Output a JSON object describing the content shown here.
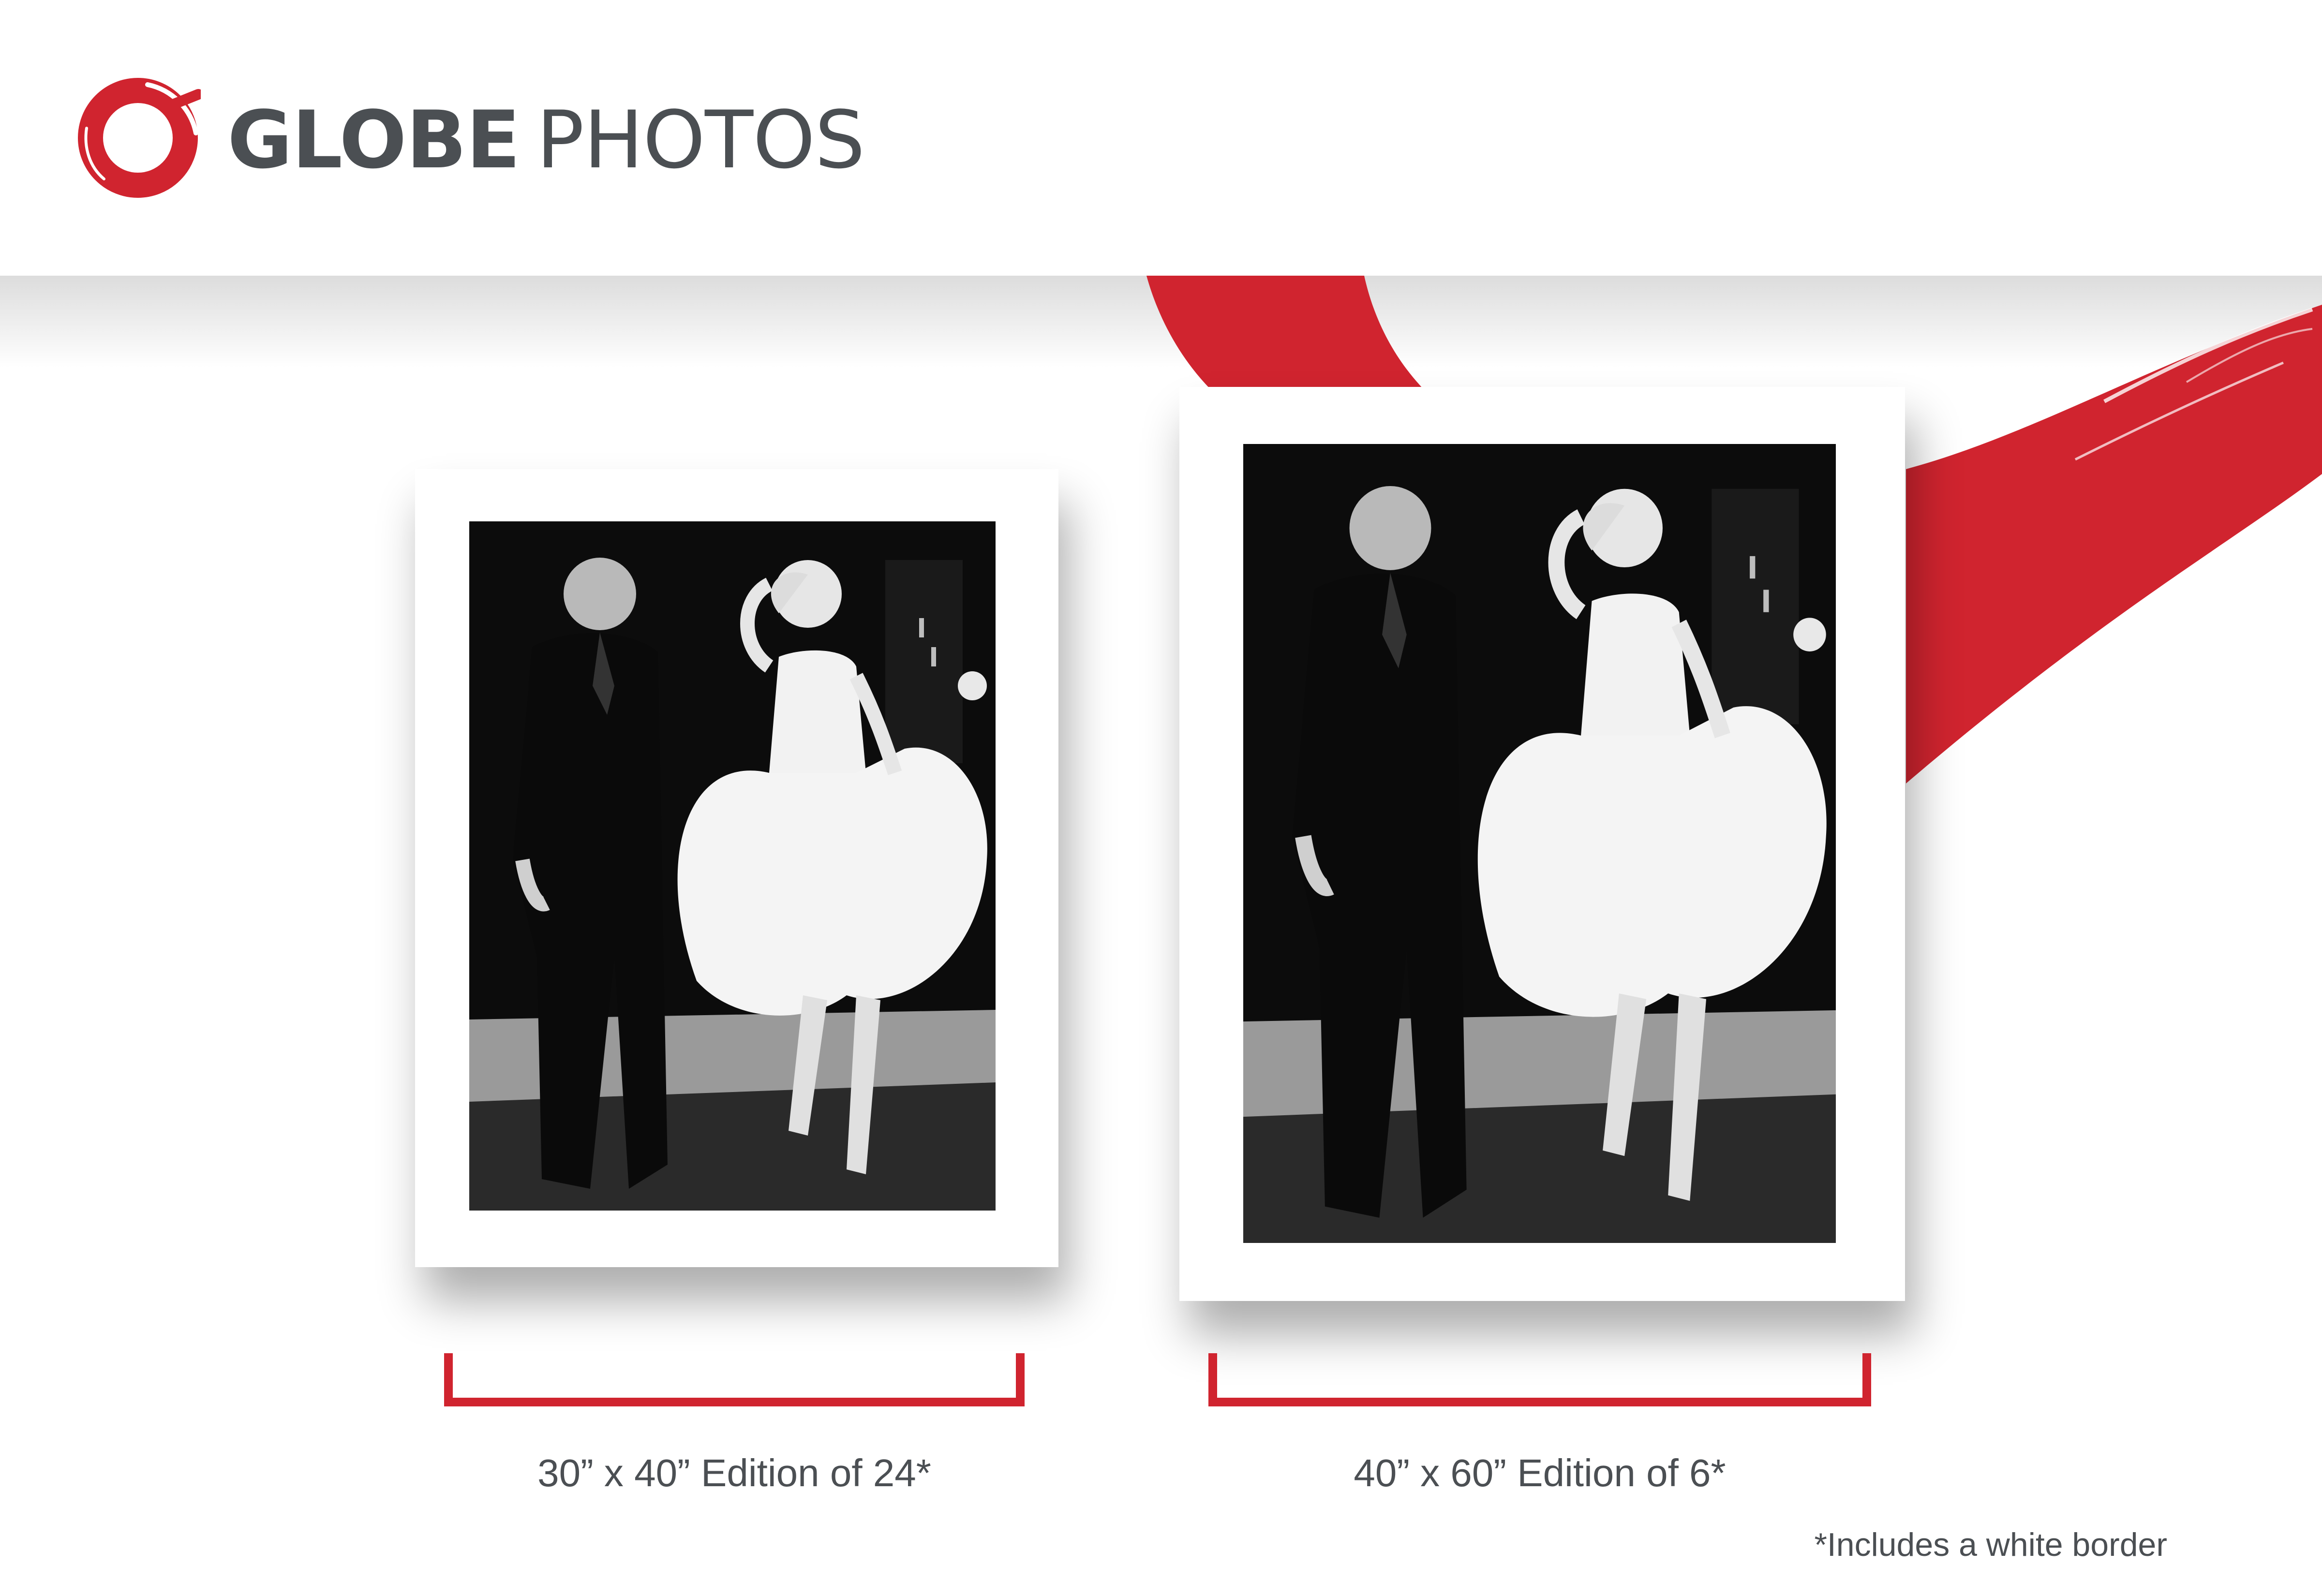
{
  "brand": {
    "name_bold": "GLOBE",
    "name_light": "PHOTOS",
    "logo_icon": "red-ring-logo-icon",
    "accent_color": "#d0242f",
    "text_color": "#4b4f53"
  },
  "prints": [
    {
      "image": "black-and-white-photo-woman-in-white-dress-and-man-in-suit",
      "caption": "30” x 40” Edition of 24*"
    },
    {
      "image": "black-and-white-photo-woman-in-white-dress-and-man-in-suit",
      "caption": "40” x 60” Edition of 6*"
    }
  ],
  "footnote": "*Includes a white border"
}
